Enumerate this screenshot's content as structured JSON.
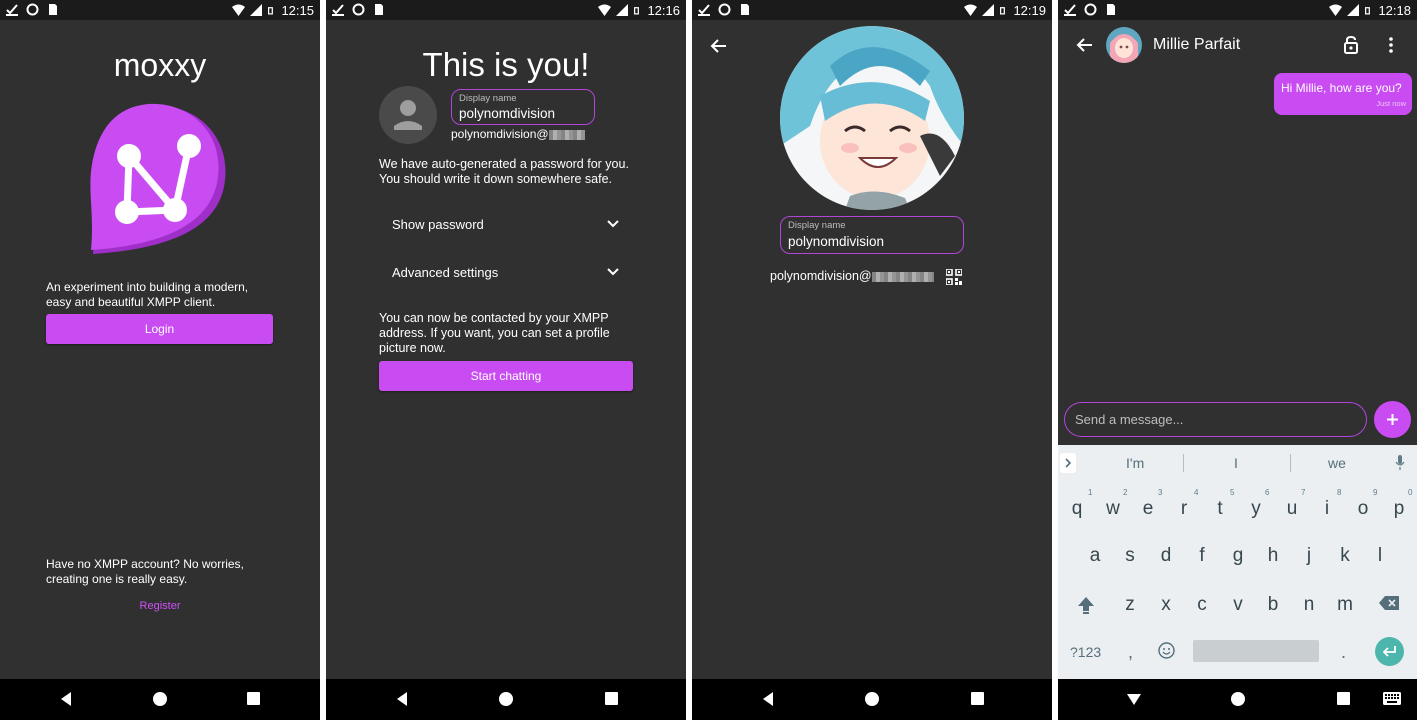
{
  "screens": [
    {
      "status": {
        "time": "12:15"
      },
      "app_title": "moxxy",
      "tagline": "An experiment into building a modern, easy and beautiful XMPP client.",
      "login_label": "Login",
      "no_account_text": "Have no XMPP account? No worries, creating one is really easy.",
      "register_label": "Register"
    },
    {
      "status": {
        "time": "12:16"
      },
      "heading": "This is you!",
      "display_name_label": "Display name",
      "display_name_value": "polynomdivision",
      "jid_prefix": "polynomdivision@",
      "password_note": "We have auto-generated a password for you. You should write it down somewhere safe.",
      "show_password_label": "Show password",
      "advanced_settings_label": "Advanced settings",
      "contact_note": "You can now be contacted by your XMPP address. If you want, you can set a profile picture now.",
      "start_chatting_label": "Start chatting"
    },
    {
      "status": {
        "time": "12:19"
      },
      "display_name_label": "Display name",
      "display_name_value": "polynomdivision",
      "jid_prefix": "polynomdivision@"
    },
    {
      "status": {
        "time": "12:18"
      },
      "contact_name": "Millie Parfait",
      "message_text": "Hi Millie, how are you?",
      "message_time": "Just now",
      "input_placeholder": "Send a message...",
      "suggestions": [
        "I'm",
        "I",
        "we"
      ],
      "keyboard": {
        "row1": [
          "q",
          "w",
          "e",
          "r",
          "t",
          "y",
          "u",
          "i",
          "o",
          "p"
        ],
        "row1_hints": [
          "1",
          "2",
          "3",
          "4",
          "5",
          "6",
          "7",
          "8",
          "9",
          "0"
        ],
        "row2": [
          "a",
          "s",
          "d",
          "f",
          "g",
          "h",
          "j",
          "k",
          "l"
        ],
        "row3": [
          "z",
          "x",
          "c",
          "v",
          "b",
          "n",
          "m"
        ],
        "symbols_key": "?123",
        "comma_key": ",",
        "period_key": "."
      }
    }
  ],
  "colors": {
    "accent": "#c84cf2",
    "background": "#303030",
    "bar": "#1b1b1b"
  }
}
